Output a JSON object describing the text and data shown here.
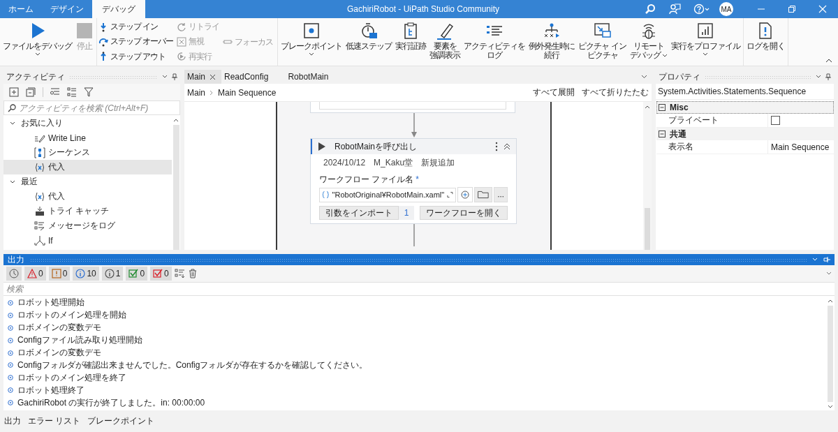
{
  "title_bar": {
    "tabs": [
      {
        "label": "ホーム",
        "selected": false
      },
      {
        "label": "デザイン",
        "selected": false
      },
      {
        "label": "デバッグ",
        "selected": true
      }
    ],
    "title": "GachiriRobot - UiPath Studio Community",
    "avatar": "MA"
  },
  "ribbon": {
    "groups": [
      {
        "kind": "large",
        "buttons": [
          {
            "kind": "play",
            "lines": [
              "ファイルをデバッグ"
            ],
            "disabled": false,
            "caret": true
          },
          {
            "kind": "stop",
            "lines": [
              "停止"
            ],
            "disabled": true,
            "caret": false
          }
        ]
      },
      {
        "kind": "small",
        "columns": [
          [
            {
              "kind": "step-in",
              "label": "ステップ イン",
              "disabled": false
            },
            {
              "kind": "step-over",
              "label": "ステップ オーバー",
              "disabled": false
            },
            {
              "kind": "step-out",
              "label": "ステップ アウト",
              "disabled": false
            }
          ],
          [
            {
              "kind": "retry",
              "label": "リトライ",
              "disabled": true
            },
            {
              "kind": "ignore",
              "label": "無視",
              "disabled": true
            },
            {
              "kind": "restart",
              "label": "再実行",
              "disabled": true
            }
          ],
          [
            {
              "kind": "focus",
              "label": "フォーカス",
              "disabled": true
            }
          ]
        ]
      },
      {
        "kind": "large",
        "buttons": [
          {
            "kind": "breakpoint",
            "lines": [
              "ブレークポイント"
            ],
            "disabled": false,
            "caret": true
          },
          {
            "kind": "slow-step",
            "lines": [
              "低速ステップ"
            ],
            "disabled": false,
            "caret": false
          },
          {
            "kind": "trace",
            "lines": [
              "実行証跡"
            ],
            "disabled": false,
            "caret": false
          },
          {
            "kind": "highlight",
            "lines": [
              "要素を",
              "強調表示"
            ],
            "disabled": false,
            "caret": false
          },
          {
            "kind": "log-activity",
            "lines": [
              "アクティビティを",
              "ログ"
            ],
            "disabled": false,
            "caret": false
          },
          {
            "kind": "continue",
            "lines": [
              "例外発生時に",
              "続行"
            ],
            "disabled": false,
            "caret": false
          },
          {
            "kind": "pip",
            "lines": [
              "ピクチャ イン",
              "ピクチャ"
            ],
            "disabled": false,
            "caret": false
          },
          {
            "kind": "remote",
            "lines": [
              "リモート",
              "デバッグ"
            ],
            "disabled": false,
            "caret": true
          },
          {
            "kind": "profile",
            "lines": [
              "実行をプロファイル"
            ],
            "disabled": false,
            "caret": true
          }
        ]
      },
      {
        "kind": "large",
        "buttons": [
          {
            "kind": "open-log",
            "lines": [
              "ログを開く"
            ],
            "disabled": false,
            "caret": false
          }
        ]
      }
    ]
  },
  "activities": {
    "title": "アクティビティ",
    "search": {
      "placeholder": "アクティビティを検索 (Ctrl+Alt+F)"
    },
    "tree": [
      {
        "label": "お気に入り",
        "expanded": true,
        "children": [
          {
            "kind": "write-line",
            "label": "Write Line",
            "selected": false
          },
          {
            "kind": "sequence",
            "label": "シーケンス",
            "selected": false
          },
          {
            "kind": "assign",
            "label": "代入",
            "selected": true
          }
        ]
      },
      {
        "label": "最近",
        "expanded": true,
        "children": [
          {
            "kind": "assign",
            "label": "代入",
            "selected": false
          },
          {
            "kind": "try-catch",
            "label": "トライ キャッチ",
            "selected": false
          },
          {
            "kind": "log",
            "label": "メッセージをログ",
            "selected": false
          },
          {
            "kind": "if",
            "label": "If",
            "selected": false
          }
        ]
      }
    ]
  },
  "designer": {
    "tabs": [
      {
        "label": "Main",
        "selected": true,
        "closable": true
      },
      {
        "label": "ReadConfig",
        "selected": false,
        "closable": false
      },
      {
        "label": "RobotMain",
        "selected": false,
        "closable": false
      }
    ],
    "breadcrumb": [
      "Main",
      "Main Sequence"
    ],
    "actions": [
      "すべて展開",
      "すべて折りたたむ"
    ],
    "activity": {
      "title": "RobotMainを呼び出し",
      "annotation": "2024/10/12　M_Kaku堂　新規追加",
      "field_label": "ワークフロー ファイル名",
      "required_mark": "*",
      "field_value": "\"RobotOriginal¥RobotMain.xaml\"",
      "import_button": "引数をインポート",
      "argument_count": "1",
      "open_button": "ワークフローを開く"
    }
  },
  "properties": {
    "title": "プロパティ",
    "type": "System.Activities.Statements.Sequence",
    "categories": [
      {
        "label": "Misc",
        "expanded": true,
        "rows": [
          {
            "kind": "checkbox",
            "label": "プライベート",
            "checked": false
          }
        ]
      },
      {
        "label": "共通",
        "expanded": true,
        "rows": [
          {
            "kind": "text",
            "label": "表示名",
            "value": "Main Sequence"
          }
        ]
      }
    ]
  },
  "output": {
    "title": "出力",
    "filters": [
      {
        "kind": "time"
      },
      {
        "kind": "error",
        "count": "0"
      },
      {
        "kind": "warning",
        "count": "0"
      },
      {
        "kind": "info",
        "count": "10"
      },
      {
        "kind": "trace",
        "count": "1"
      },
      {
        "kind": "success",
        "count": "0"
      },
      {
        "kind": "failure",
        "count": "0"
      }
    ],
    "search": {
      "placeholder": "検索"
    },
    "lines": [
      "ロボット処理開始",
      "ロボットのメイン処理を開始",
      "ロボメインの変数デモ",
      "Configファイル読み取り処理開始",
      "ロボメインの変数デモ",
      "Configフォルダが確認出来ませんでした。Configフォルダが存在するかを確認してください。",
      "ロボットのメイン処理を終了",
      "ロボット処理終了",
      "GachiriRobot の実行が終了しました。in: 00:00:00"
    ]
  },
  "bottom_tabs": [
    "出力",
    "エラー リスト",
    "ブレークポイント"
  ]
}
